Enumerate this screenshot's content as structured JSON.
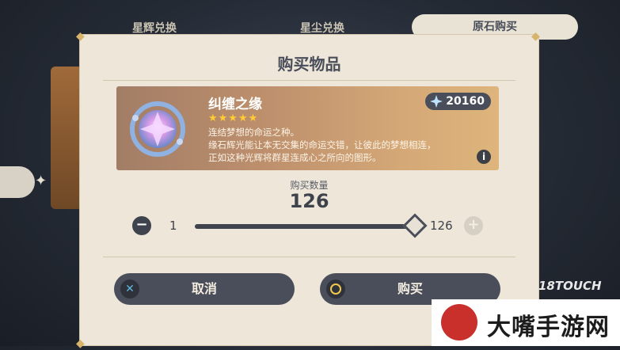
{
  "tabs": [
    {
      "label": "星辉兑换"
    },
    {
      "label": "星尘兑换"
    },
    {
      "label": "原石购买"
    }
  ],
  "dialog": {
    "title": "购买物品",
    "item": {
      "name": "纠缠之缘",
      "stars": "★★★★★",
      "rarity": 5,
      "price": "20160",
      "desc_lines": [
        "连结梦想的命运之种。",
        "缘石辉光能让本无交集的命运交错，让彼此的梦想相连，",
        "正如这种光辉将群星连成心之所向的图形。"
      ]
    },
    "quantity": {
      "label": "购买数量",
      "value": "126",
      "min": "1",
      "max": "126",
      "slider_fraction": 1.0
    },
    "buttons": {
      "cancel": "取消",
      "buy": "购买"
    }
  },
  "watermarks": {
    "site_18": "18TOUCH",
    "brand": "大嘴手游网"
  },
  "icons": {
    "item": "intertwined-fate-icon",
    "currency": "primogem-icon",
    "info": "info-icon",
    "minus": "minus-icon",
    "plus": "plus-icon",
    "cancel": "cancel-x-icon",
    "confirm": "confirm-circle-icon"
  },
  "colors": {
    "dialog_bg": "#ede6d9",
    "button_bg": "#4a4e5a",
    "star": "#ffcc33",
    "card_gradient_end": "#deb57c"
  }
}
